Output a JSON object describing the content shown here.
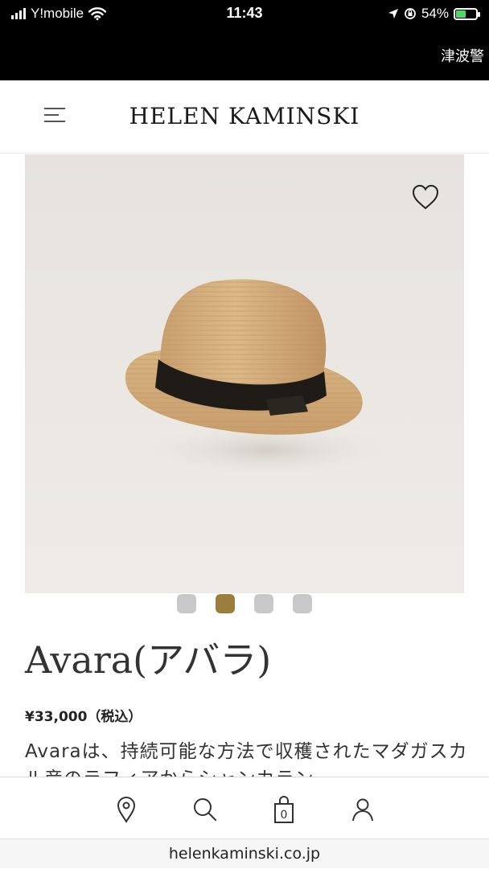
{
  "status_bar": {
    "carrier": "Y!mobile",
    "time": "11:43",
    "battery_percent": "54%",
    "battery_level": 0.54,
    "banner": "津波警"
  },
  "header": {
    "brand": "HELEN KAMINSKI"
  },
  "product": {
    "name": "Avara(アバラ)",
    "price": "¥33,000（税込）",
    "description": "Avaraは、持続可能な方法で収穫されたマダガスカル産のラフィアからシャンカラン",
    "carousel_total": 4,
    "carousel_active": 2
  },
  "browser": {
    "url": "helenkaminski.co.jp"
  },
  "colors": {
    "accent": "#9b7d3e",
    "dot_inactive": "#c8c8c8",
    "battery": "#4cd964"
  },
  "icons": {
    "menu": "menu-icon",
    "favorite": "heart-icon",
    "store": "location-pin-icon",
    "search": "search-icon",
    "bag": "shopping-bag-icon",
    "account": "user-icon"
  }
}
